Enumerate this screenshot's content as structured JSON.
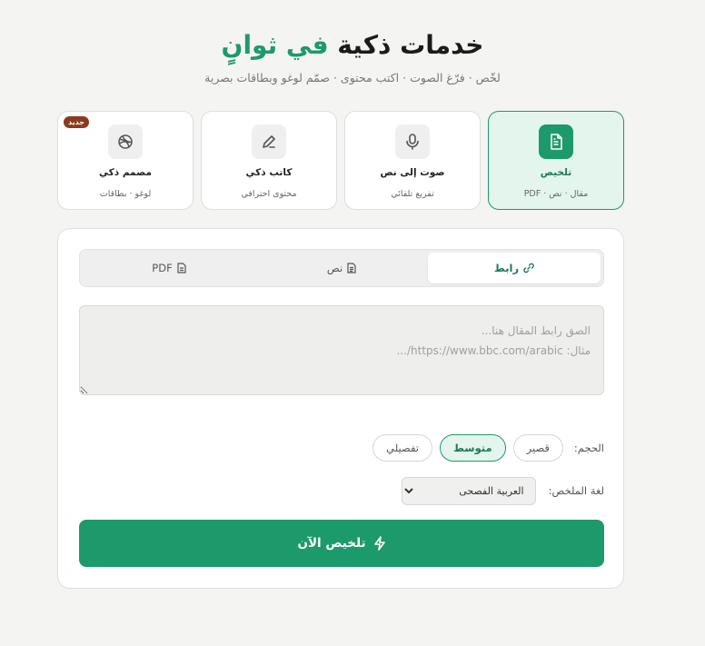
{
  "header": {
    "title_main": "خدمات ذكية",
    "title_accent": "في ثوانٍ",
    "subtitle": "لخّص · فرّغ الصوت · اكتب محتوى · صمّم لوغو وبطاقات بصرية"
  },
  "services": [
    {
      "name": "تلخيص",
      "desc": "مقال · نص · PDF",
      "icon": "document-icon",
      "active": true
    },
    {
      "name": "صوت إلى نص",
      "desc": "تفريغ تلقائي",
      "icon": "microphone-icon",
      "active": false
    },
    {
      "name": "كاتب ذكي",
      "desc": "محتوى احترافي",
      "icon": "pen-icon",
      "active": false
    },
    {
      "name": "مصمم ذكي",
      "desc": "لوغو · بطاقات",
      "icon": "palette-icon",
      "active": false,
      "badge": "جديد"
    }
  ],
  "tabs": [
    {
      "label": "رابط",
      "icon": "link-icon",
      "active": true
    },
    {
      "label": "نص",
      "icon": "text-file-icon",
      "active": false
    },
    {
      "label": "PDF",
      "icon": "pdf-file-icon",
      "active": false
    }
  ],
  "input": {
    "value": "",
    "placeholder": "الصق رابط المقال هنا...\nمثال: https://www.bbc.com/arabic/..."
  },
  "size": {
    "label": "الحجم:",
    "options": [
      "قصير",
      "متوسط",
      "تفصيلي"
    ],
    "selected": "متوسط"
  },
  "language": {
    "label": "لغة الملخص:",
    "selected": "العربية الفصحى"
  },
  "submit": {
    "label": "تلخيص الآن",
    "icon": "lightning-icon"
  },
  "colors": {
    "accent": "#1d9a6c",
    "accent_light": "#e4f5ee",
    "badge": "#8b3a1e"
  }
}
